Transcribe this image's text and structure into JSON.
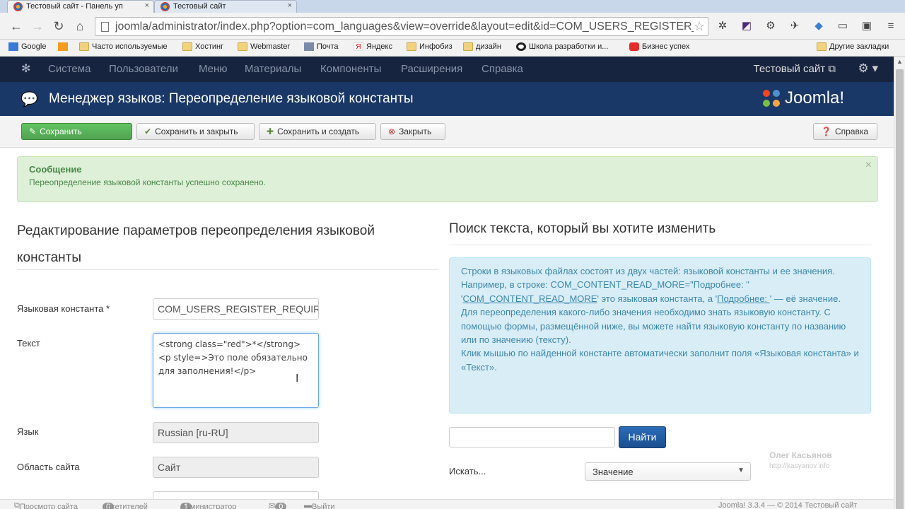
{
  "browser": {
    "tabs": [
      {
        "title": "Тестовый сайт - Панель уп",
        "close": "×"
      },
      {
        "title": "Тестовый сайт",
        "close": "×"
      }
    ],
    "url": "joomla/administrator/index.php?option=com_languages&view=override&layout=edit&id=COM_USERS_REGISTER_REQUIRED",
    "bookmarks": [
      {
        "label": "Google",
        "icon": "google-icon"
      },
      {
        "label": "",
        "icon": "odnoklassniki-icon"
      },
      {
        "label": "Часто используемые",
        "icon": "folder-icon"
      },
      {
        "label": "Хостинг",
        "icon": "folder-icon"
      },
      {
        "label": "Webmaster",
        "icon": "folder-icon"
      },
      {
        "label": "Почта",
        "icon": "mail-icon"
      },
      {
        "label": "Яндекс",
        "icon": "yandex-icon"
      },
      {
        "label": "Инфобиз",
        "icon": "folder-icon"
      },
      {
        "label": "дизайн",
        "icon": "folder-icon"
      },
      {
        "label": "Школа разработки и...",
        "icon": "site-icon"
      },
      {
        "label": "Бизнес успех",
        "icon": "youtube-icon"
      }
    ],
    "other_bookmarks": "Другие закладки"
  },
  "nav": {
    "items": [
      "Система",
      "Пользователи",
      "Меню",
      "Материалы",
      "Компоненты",
      "Расширения",
      "Справка"
    ],
    "site_link": "Тестовый сайт ⧉",
    "gear": "⚙ ▾"
  },
  "header": {
    "title": "Менеджер языков: Переопределение языковой константы",
    "brand": "Joomla!"
  },
  "toolbar": {
    "save": "Сохранить",
    "save_close": "Сохранить и закрыть",
    "save_new": "Сохранить и создать",
    "close": "Закрыть",
    "help": "Справка"
  },
  "alert": {
    "heading": "Сообщение",
    "message": "Переопределение языковой константы успешно сохранено.",
    "close": "×"
  },
  "form": {
    "heading": "Редактирование параметров переопределения языковой константы",
    "constant_label": "Языковая константа *",
    "constant_value": "COM_USERS_REGISTER_REQUIRED",
    "text_label": "Текст",
    "text_value": "<strong class=\"red\">*</strong> <p style=>Это поле обязательно для заполнения!</p>",
    "language_label": "Язык",
    "language_value": "Russian [ru-RU]",
    "client_label": "Область сайта",
    "client_value": "Сайт"
  },
  "search": {
    "heading": "Поиск текста, который вы хотите изменить",
    "info_1": "Строки в языковых файлах состоят из двух частей: языковой константы и ее значения.",
    "info_2a": "Например, в строке: COM_CONTENT_READ_MORE=\"Подробнее: \"",
    "info_2b_pre": "'",
    "info_2b_const": "COM_CONTENT_READ_MORE",
    "info_2b_mid": "' это языковая константа, а '",
    "info_2b_val": "Подробнее: ",
    "info_2b_post": "' — её значение.",
    "info_3": "Для переопределения какого-либо значения необходимо знать языковую константу. С помощью формы, размещённой ниже, вы можете найти языковую константу по названию или по значению (тексту).",
    "info_4": "Клик мышью по найденной константе автоматически заполнит поля «Языковая константа» и «Текст».",
    "find_button": "Найти",
    "search_in_label": "Искать...",
    "search_in_value": "Значение"
  },
  "watermark": {
    "name": "Олег Касьянов",
    "url": "http://kasyanov.info"
  },
  "status": {
    "preview": "Просмотр сайта",
    "visitors_count": "0",
    "visitors": "посетителей",
    "admins_count": "1",
    "admins": "Администратор",
    "messages_count": "0",
    "logout": "Выйти",
    "version": "Joomla! 3.3.4 — © 2014 Тестовый сайт"
  }
}
